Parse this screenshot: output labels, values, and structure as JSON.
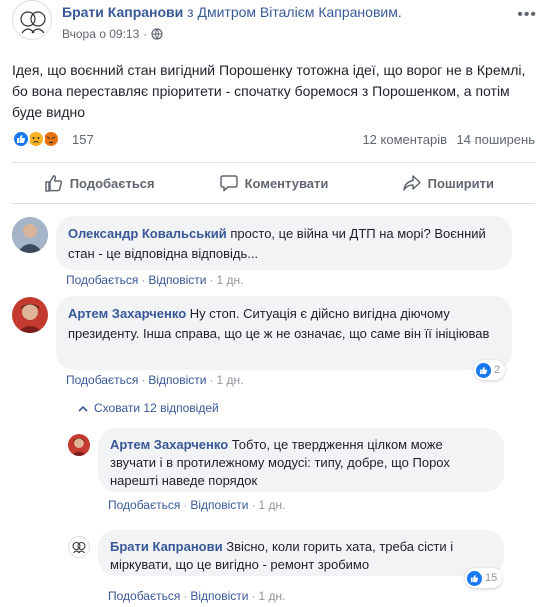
{
  "post": {
    "author": "Брати Капранови",
    "with_text": "з Дмитром Віталієм Капрановим.",
    "timestamp": "Вчора о 09:13",
    "audience_icon": "globe-icon",
    "text": "Ідея, що воєнний стан вигідний Порошенку тотожна ідеї, що ворог не в Кремлі, бо вона переставляє пріоритети - спочатку боремося з Порошенком, а потім буде видно",
    "reactions": {
      "icons": [
        "like-icon",
        "sad-icon",
        "angry-icon"
      ],
      "count": "157"
    },
    "comments_count": "12 коментарів",
    "shares_count": "14 поширень",
    "actions": {
      "like": "Подобається",
      "comment": "Коментувати",
      "share": "Поширити"
    }
  },
  "comments": [
    {
      "author": "Олександр Ковальський",
      "text": "просто, це війна чи ДТП на морі? Воєнний стан - це відповідна відповідь...",
      "like": "Подобається",
      "reply": "Відповісти",
      "time": "1 дн."
    },
    {
      "author": "Артем Захарченко",
      "text": "Ну стоп. Ситуація є дійсно вигідна діючому президенту. Інша справа, що це ж не означає, що саме він її ініціював",
      "like": "Подобається",
      "reply": "Відповісти",
      "time": "1 дн.",
      "reaction_count": "2"
    }
  ],
  "hide_replies": "Сховати 12 відповідей",
  "replies": [
    {
      "author": "Артем Захарченко",
      "text": "Тобто, це твердження цілком може звучати і в протилежному модусі: типу, добре, що Порох нарешті наведе порядок",
      "like": "Подобається",
      "reply": "Відповісти",
      "time": "1 дн."
    },
    {
      "author": "Брати Капранови",
      "text": "Звісно, коли горить хата, треба сісти і міркувати, що це вигідно - ремонт зробимо",
      "like": "Подобається",
      "reply": "Відповісти",
      "time": "1 дн.",
      "reaction_count": "15"
    }
  ],
  "colors": {
    "link": "#385898",
    "like_blue": "#1877f2",
    "bubble": "#f2f3f5",
    "muted": "#90949c"
  }
}
